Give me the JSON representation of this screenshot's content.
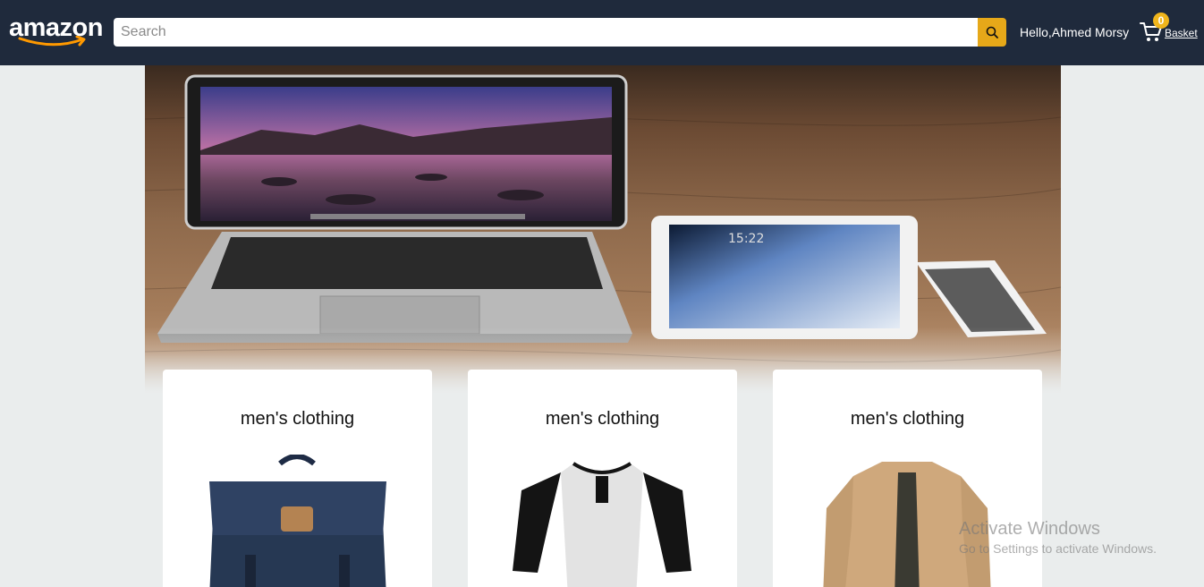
{
  "header": {
    "logo_text": "amazon",
    "search_placeholder": "Search",
    "greeting": "Hello,Ahmed Morsy",
    "basket_count": "0",
    "basket_label": "Basket"
  },
  "products": [
    {
      "title": "men's clothing",
      "image_alt": "backpack"
    },
    {
      "title": "men's clothing",
      "image_alt": "raglan shirt"
    },
    {
      "title": "men's clothing",
      "image_alt": "jacket"
    }
  ],
  "watermark": {
    "line1": "Activate Windows",
    "line2": "Go to Settings to activate Windows."
  },
  "colors": {
    "header_bg": "#1f2a3c",
    "search_button": "#e6a819",
    "basket_badge": "#f0b51c",
    "page_bg": "#eaeded"
  }
}
